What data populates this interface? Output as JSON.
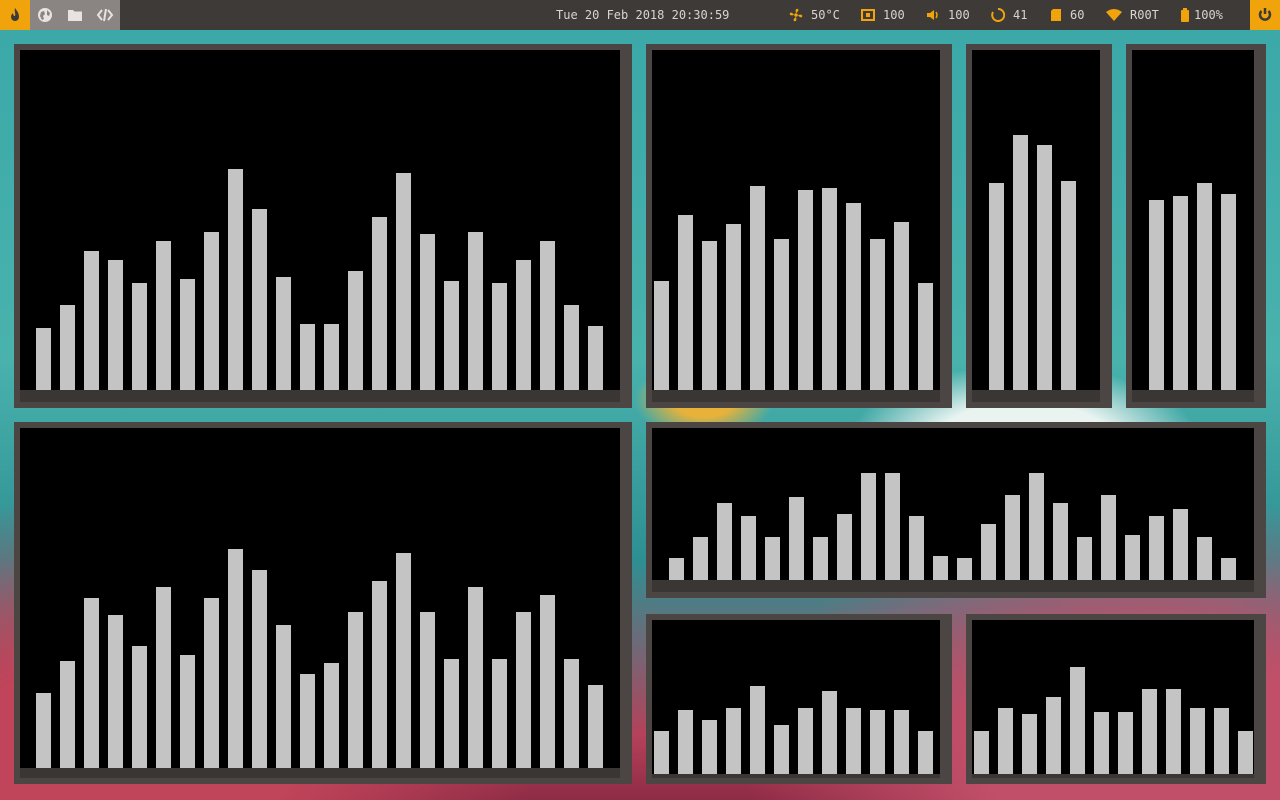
{
  "topbar": {
    "workspaces": [
      {
        "icon": "flame-icon",
        "active": true
      },
      {
        "icon": "globe-icon",
        "active": false
      },
      {
        "icon": "folder-icon",
        "active": false
      },
      {
        "icon": "code-icon",
        "active": false
      }
    ],
    "datetime": "Tue 20 Feb 2018 20:30:59",
    "stats": {
      "temperature": "50°C",
      "cpu": "100",
      "volume": "100",
      "updates": "41",
      "memory": "60",
      "network": "R00T",
      "battery": "100%"
    },
    "accent_color": "#f0a30a"
  },
  "visualizers": [
    {
      "id": "viz-1",
      "values": [
        62,
        85,
        139,
        130,
        107,
        149,
        111,
        158,
        221,
        181,
        113,
        66,
        66,
        119,
        173,
        217,
        156,
        109,
        158,
        107,
        130,
        149,
        85,
        64
      ]
    },
    {
      "id": "viz-2",
      "values": [
        109,
        175,
        149,
        166,
        204,
        151,
        200,
        202,
        187,
        151,
        168,
        107
      ]
    },
    {
      "id": "viz-3",
      "values": [
        207,
        255,
        245,
        209
      ]
    },
    {
      "id": "viz-4",
      "values": [
        190,
        194,
        207,
        196
      ]
    },
    {
      "id": "viz-5",
      "values": [
        75,
        107,
        170,
        153,
        122,
        181,
        113,
        170,
        219,
        198,
        143,
        94,
        105,
        156,
        187,
        215,
        156,
        109,
        181,
        109,
        156,
        173,
        109,
        83
      ]
    },
    {
      "id": "viz-6",
      "values": [
        22,
        43,
        77,
        64,
        43,
        83,
        43,
        66,
        107,
        107,
        64,
        24,
        22,
        56,
        85,
        107,
        77,
        43,
        85,
        45,
        64,
        71,
        43,
        22
      ]
    },
    {
      "id": "viz-7",
      "values": [
        43,
        64,
        54,
        66,
        88,
        49,
        66,
        83,
        66,
        64,
        64,
        43
      ]
    },
    {
      "id": "viz-8",
      "values": [
        43,
        66,
        60,
        77,
        107,
        62,
        62,
        85,
        85,
        66,
        66,
        43
      ]
    }
  ],
  "bar_color": "#c4c4c4"
}
